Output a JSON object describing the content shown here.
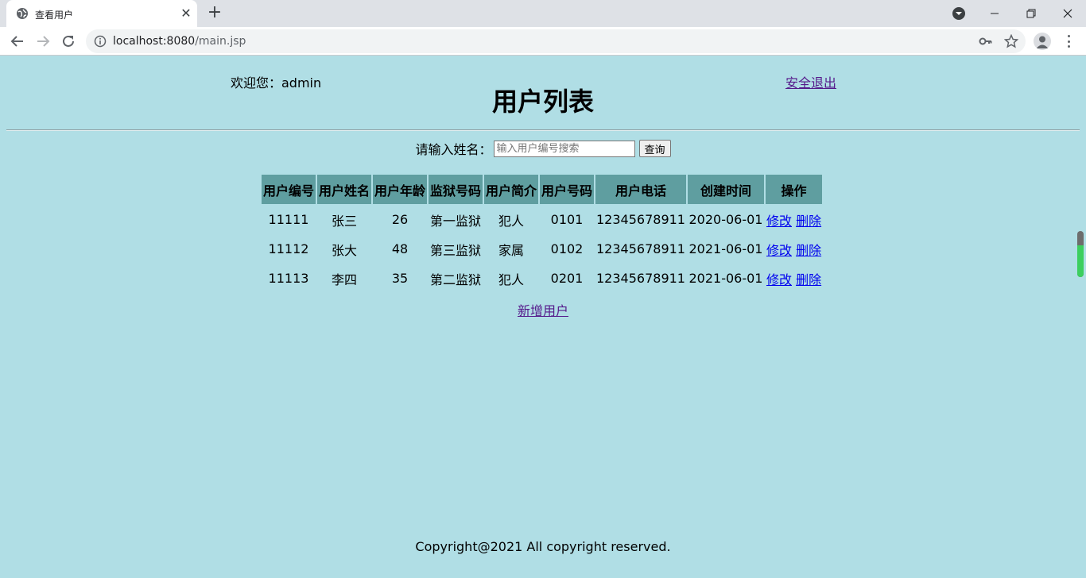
{
  "browser": {
    "tab_title": "查看用户",
    "url_host": "localhost:8080",
    "url_path": "/main.jsp"
  },
  "header": {
    "welcome": "欢迎您：admin",
    "logout": "安全退出",
    "title": "用户列表"
  },
  "search": {
    "label": "请输入姓名：",
    "placeholder": "输入用户编号搜索",
    "button": "查询"
  },
  "table": {
    "columns": [
      "用户编号",
      "用户姓名",
      "用户年龄",
      "监狱号码",
      "用户简介",
      "用户号码",
      "用户电话",
      "创建时间",
      "操作"
    ],
    "rows": [
      {
        "id": "11111",
        "name": "张三",
        "age": "26",
        "prison": "第一监狱",
        "intro": "犯人",
        "number": "0101",
        "phone": "12345678911",
        "created": "2020-06-01"
      },
      {
        "id": "11112",
        "name": "张大",
        "age": "48",
        "prison": "第三监狱",
        "intro": "家属",
        "number": "0102",
        "phone": "12345678911",
        "created": "2021-06-01"
      },
      {
        "id": "11113",
        "name": "李四",
        "age": "35",
        "prison": "第二监狱",
        "intro": "犯人",
        "number": "0201",
        "phone": "12345678911",
        "created": "2021-06-01"
      }
    ],
    "action_edit": "修改",
    "action_delete": "删除"
  },
  "add_user": "新增用户",
  "footer": "Copyright@2021 All copyright reserved."
}
